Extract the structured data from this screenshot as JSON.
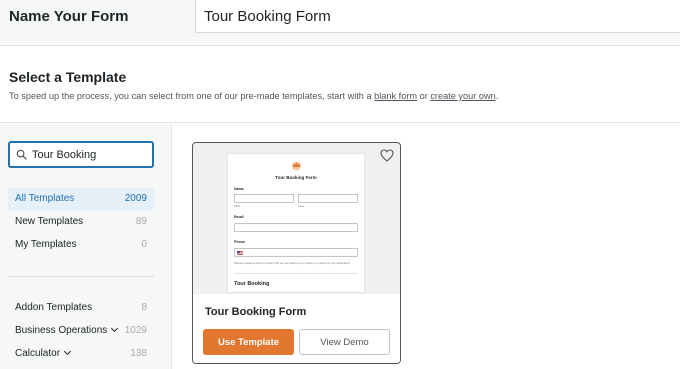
{
  "name_form": {
    "label": "Name Your Form",
    "value": "Tour Booking Form"
  },
  "select_template": {
    "title": "Select a Template",
    "desc_prefix": "To speed up the process, you can select from one of our pre-made templates, start with a ",
    "blank_form_link": "blank form",
    "desc_mid": " or ",
    "create_own_link": "create your own",
    "desc_suffix": "."
  },
  "sidebar": {
    "search_value": "Tour Booking",
    "items": [
      {
        "label": "All Templates",
        "count": "2009"
      },
      {
        "label": "New Templates",
        "count": "89"
      },
      {
        "label": "My Templates",
        "count": "0"
      },
      {
        "label": "Addon Templates",
        "count": "8"
      },
      {
        "label": "Business Operations",
        "count": "1029"
      },
      {
        "label": "Calculator",
        "count": "138"
      }
    ]
  },
  "card": {
    "name": "Tour Booking Form",
    "use_label": "Use Template",
    "demo_label": "View Demo",
    "preview": {
      "title": "Tour Booking Form",
      "name_label": "Name",
      "first_sub": "First",
      "last_sub": "Last",
      "email_label": "Email",
      "phone_label": "Phone",
      "note": "Please provide a phone number that we can reach you on when you arrive at your destination.",
      "section_heading": "Tour Booking"
    }
  },
  "colors": {
    "accent_blue": "#2271b1",
    "use_button": "#e27730"
  }
}
